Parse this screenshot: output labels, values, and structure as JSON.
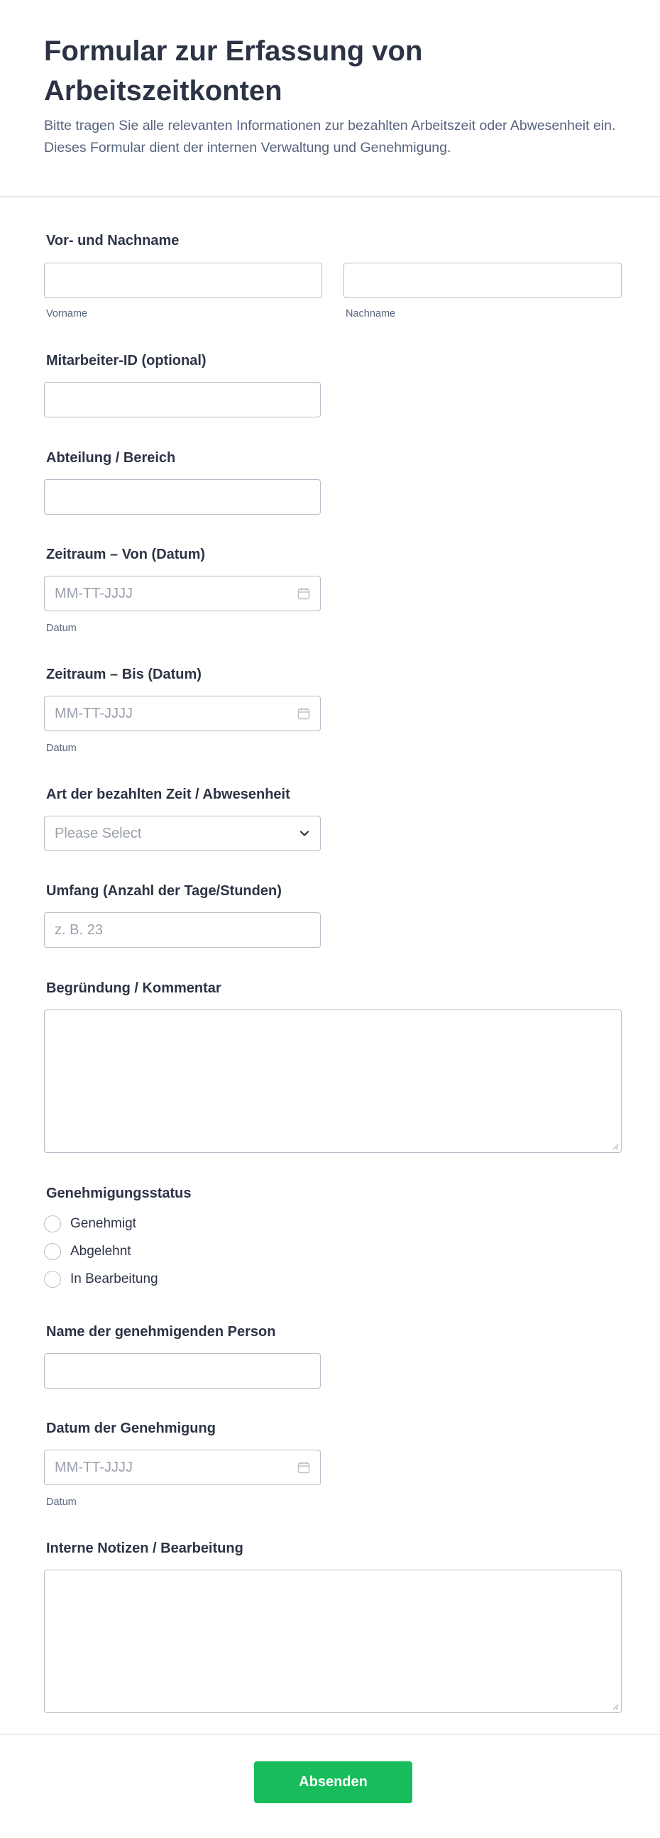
{
  "form": {
    "title": "Formular zur Erfassung von Arbeitszeitkonten",
    "description": "Bitte tragen Sie alle relevanten Informationen zur bezahlten Arbeitszeit oder Abwesenheit ein. Dieses Formular dient der internen Verwaltung und Genehmigung."
  },
  "fields": {
    "name": {
      "label": "Vor- und Nachname",
      "first_sublabel": "Vorname",
      "last_sublabel": "Nachname",
      "first_value": "",
      "last_value": ""
    },
    "employee_id": {
      "label": "Mitarbeiter-ID (optional)",
      "value": ""
    },
    "department": {
      "label": "Abteilung / Bereich",
      "value": ""
    },
    "date_from": {
      "label": "Zeitraum – Von (Datum)",
      "placeholder": "MM-TT-JJJJ",
      "sublabel": "Datum",
      "icon": "calendar-icon"
    },
    "date_to": {
      "label": "Zeitraum – Bis (Datum)",
      "placeholder": "MM-TT-JJJJ",
      "sublabel": "Datum",
      "icon": "calendar-icon"
    },
    "time_type": {
      "label": "Art der bezahlten Zeit / Abwesenheit",
      "selected": "Please Select",
      "icon": "chevron-down-icon"
    },
    "amount": {
      "label": "Umfang (Anzahl der Tage/Stunden)",
      "placeholder": "z. B. 23"
    },
    "reason": {
      "label": "Begründung / Kommentar",
      "value": ""
    },
    "approval_status": {
      "label": "Genehmigungsstatus",
      "options": [
        "Genehmigt",
        "Abgelehnt",
        "In Bearbeitung"
      ]
    },
    "approver": {
      "label": "Name der genehmigenden Person",
      "value": ""
    },
    "approval_date": {
      "label": "Datum der Genehmigung",
      "placeholder": "MM-TT-JJJJ",
      "sublabel": "Datum",
      "icon": "calendar-icon"
    },
    "notes": {
      "label": "Interne Notizen / Bearbeitung",
      "value": ""
    }
  },
  "submit": {
    "label": "Absenden",
    "color": "#18bd5b"
  },
  "colors": {
    "text": "#2c3345",
    "muted": "#57647e",
    "border": "#b8bdc9",
    "placeholder": "#9aa0ad"
  }
}
